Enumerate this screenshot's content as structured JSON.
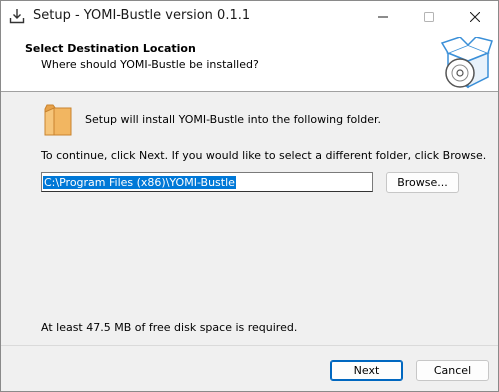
{
  "window": {
    "title": "Setup - YOMI-Bustle version 0.1.1",
    "controls": {
      "minimize": "—",
      "maximize": "☐",
      "close": "✕"
    }
  },
  "header": {
    "title": "Select Destination Location",
    "subtitle": "Where should YOMI-Bustle be installed?",
    "icon": "setup-box-disc-icon"
  },
  "body": {
    "folder_icon": "folder-icon",
    "install_message": "Setup will install YOMI-Bustle into the following folder.",
    "continue_message": "To continue, click Next. If you would like to select a different folder, click Browse.",
    "destination_path": "C:\\Program Files (x86)\\YOMI-Bustle",
    "browse_label": "Browse...",
    "disk_space_message": "At least 47.5 MB of free disk space is required."
  },
  "footer": {
    "next_label": "Next",
    "cancel_label": "Cancel"
  },
  "colors": {
    "accent": "#0078d7",
    "button_focus_border": "#0067c0",
    "window_background": "#f0f0f0",
    "header_background": "#ffffff",
    "folder_color": "#f2b661"
  }
}
